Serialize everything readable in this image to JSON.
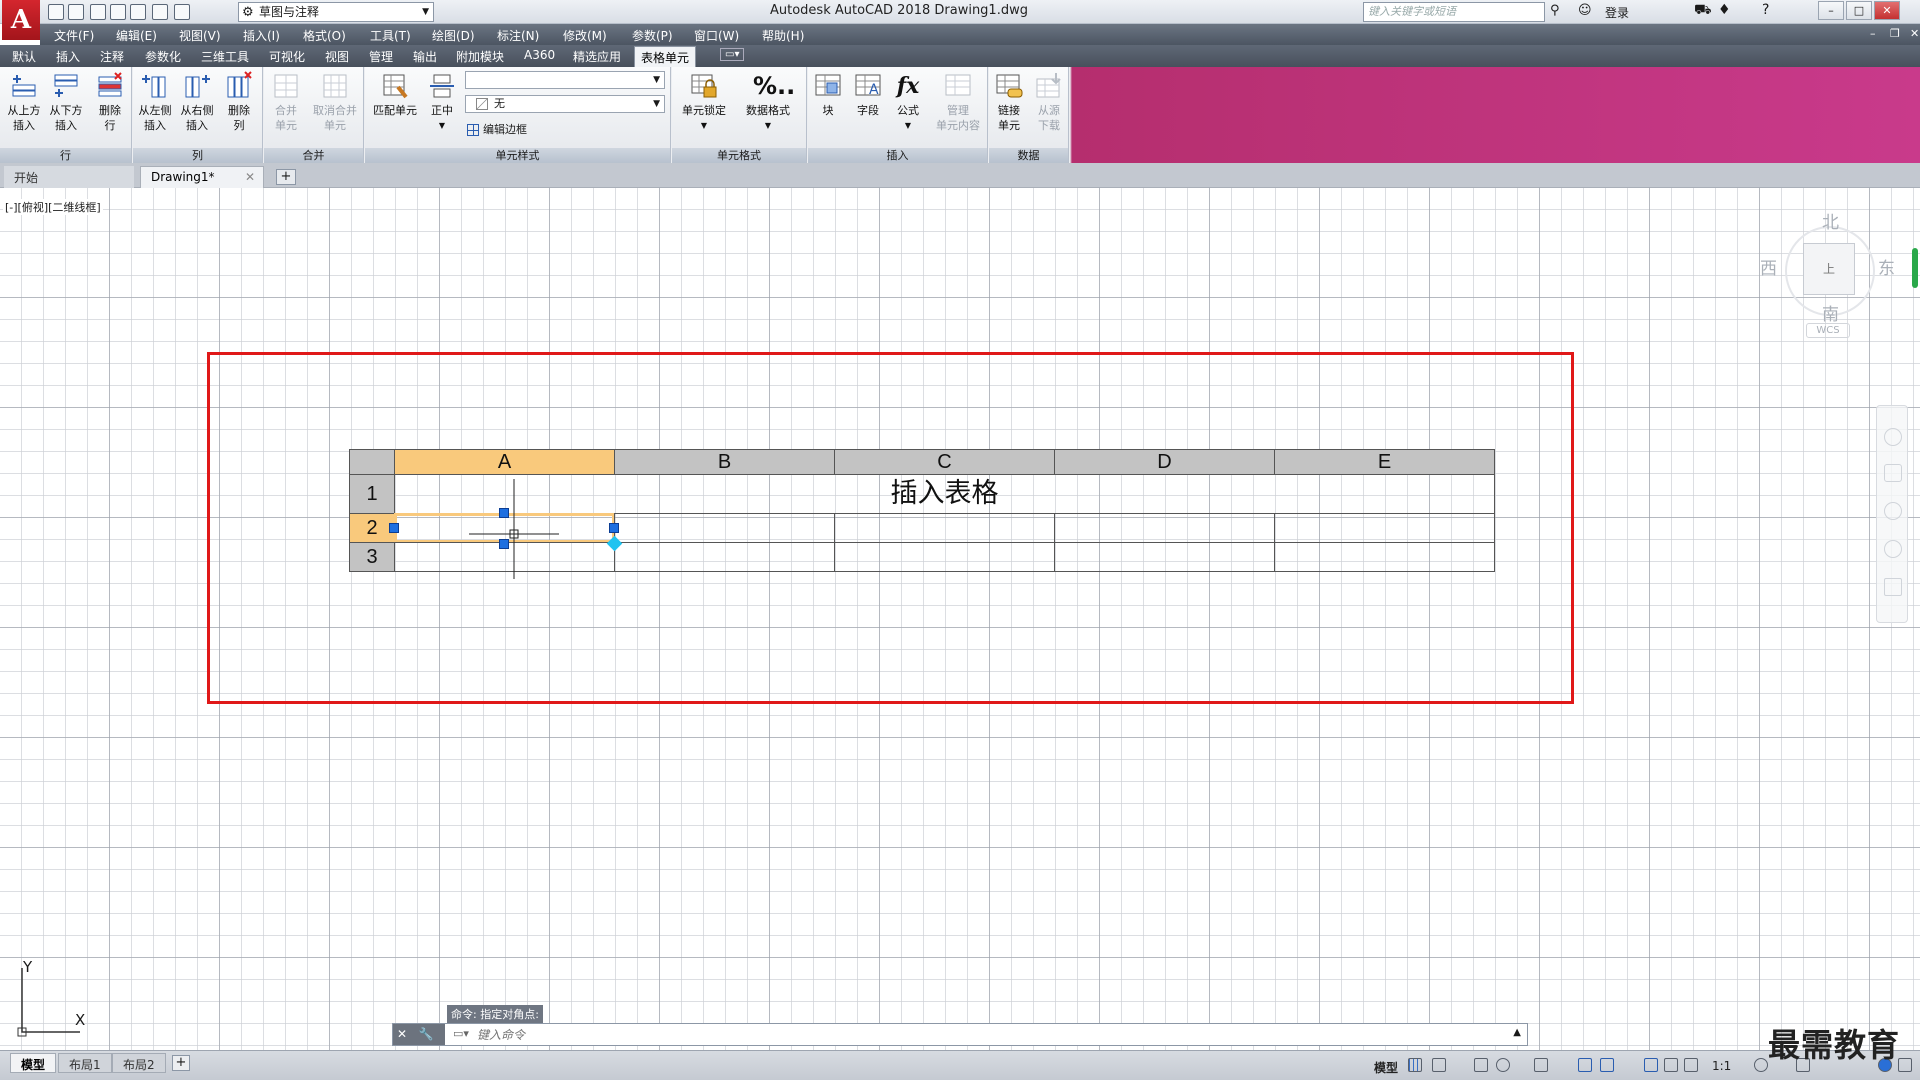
{
  "app": {
    "logo": "A",
    "title": "Autodesk AutoCAD 2018    Drawing1.dwg",
    "workspace": "草图与注释",
    "search_placeholder": "键入关键字或短语",
    "login": "登录"
  },
  "menu": [
    "文件(F)",
    "编辑(E)",
    "视图(V)",
    "插入(I)",
    "格式(O)",
    "工具(T)",
    "绘图(D)",
    "标注(N)",
    "修改(M)",
    "参数(P)",
    "窗口(W)",
    "帮助(H)"
  ],
  "ribbon_tabs": [
    "默认",
    "插入",
    "注释",
    "参数化",
    "三维工具",
    "可视化",
    "视图",
    "管理",
    "输出",
    "附加模块",
    "A360",
    "精选应用",
    "表格单元"
  ],
  "ribbon": {
    "panels": {
      "rows": "行",
      "columns": "列",
      "merge": "合并",
      "cell_styles": "单元样式",
      "cell_format": "单元格式",
      "insert": "插入",
      "data": "数据"
    },
    "buttons": {
      "insert_above": "从上方\n插入",
      "insert_below": "从下方\n插入",
      "delete_row": "删除\n行",
      "insert_left": "从左侧\n插入",
      "insert_right": "从右侧\n插入",
      "delete_col": "删除\n列",
      "merge_cells": "合并\n单元",
      "unmerge_cells": "取消合并\n单元",
      "match_cell": "匹配单元",
      "align_center": "正中",
      "cell_lock": "单元锁定",
      "data_format": "数据格式",
      "block": "块",
      "field": "字段",
      "formula": "公式",
      "manage_content": "管理\n单元内容",
      "link_cell": "链接\n单元",
      "download_source": "从源\n下载"
    },
    "style_dropdown": "",
    "fill_dropdown": "无",
    "edit_borders": "编辑边框"
  },
  "doc_tabs": {
    "start": "开始",
    "active": "Drawing1*"
  },
  "viewport": {
    "label": "[-][俯视][二维线框]",
    "viewcube": {
      "north": "北",
      "south": "南",
      "east": "东",
      "west": "西",
      "face": "上",
      "wcs": "WCS"
    },
    "ucs": {
      "x": "X",
      "y": "Y"
    }
  },
  "table": {
    "columns": [
      "A",
      "B",
      "C",
      "D",
      "E"
    ],
    "rows": [
      "1",
      "2",
      "3"
    ],
    "title": "插入表格",
    "selected_column": "A",
    "selected_row": "2"
  },
  "command": {
    "history": "命令: 指定对角点:",
    "placeholder": "键入命令"
  },
  "layout_tabs": [
    "模型",
    "布局1",
    "布局2"
  ],
  "status": {
    "model": "模型",
    "scale": "1:1"
  },
  "watermark": "最需教育",
  "colors": {
    "selection_frame": "#e01818",
    "selected_header": "#f9c97c",
    "grip": "#1e6fe0",
    "ribbon_accent": "#c93a8b"
  }
}
